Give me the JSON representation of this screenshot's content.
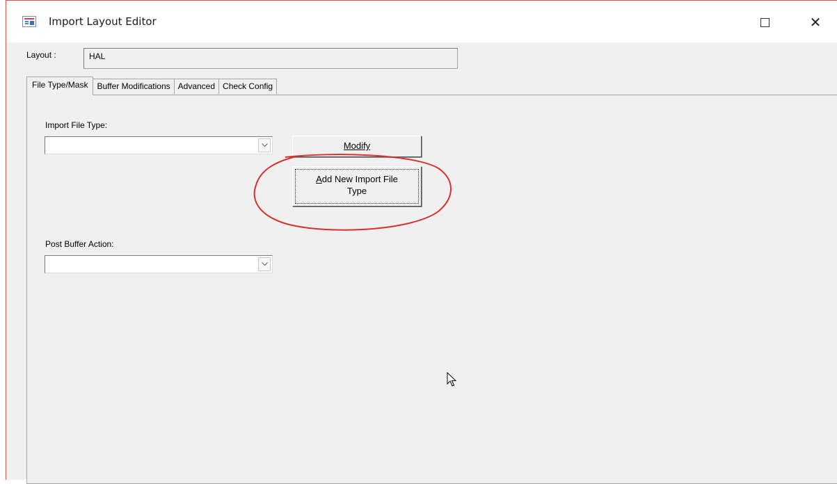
{
  "window": {
    "title": "Import Layout Editor",
    "icon": "form-icon",
    "controls": [
      "maximize-icon",
      "close-icon"
    ]
  },
  "layout": {
    "label": "Layout :",
    "value": "HAL"
  },
  "tabs": [
    {
      "label": "File Type/Mask",
      "active": true
    },
    {
      "label": "Buffer Modifications",
      "active": false
    },
    {
      "label": "Advanced",
      "active": false
    },
    {
      "label": "Check Config",
      "active": false
    }
  ],
  "file_type_panel": {
    "import_file_type_label": "Import File Type:",
    "import_file_type_value": "",
    "modify_button": "Modify",
    "add_button_accel": "A",
    "add_button_rest_line1": "dd New Import File",
    "add_button_line2": "Type",
    "post_buffer_label": "Post Buffer Action:",
    "post_buffer_value": ""
  },
  "colors": {
    "highlight_ellipse": "#d9302c",
    "window_background": "#f0f0f0"
  }
}
